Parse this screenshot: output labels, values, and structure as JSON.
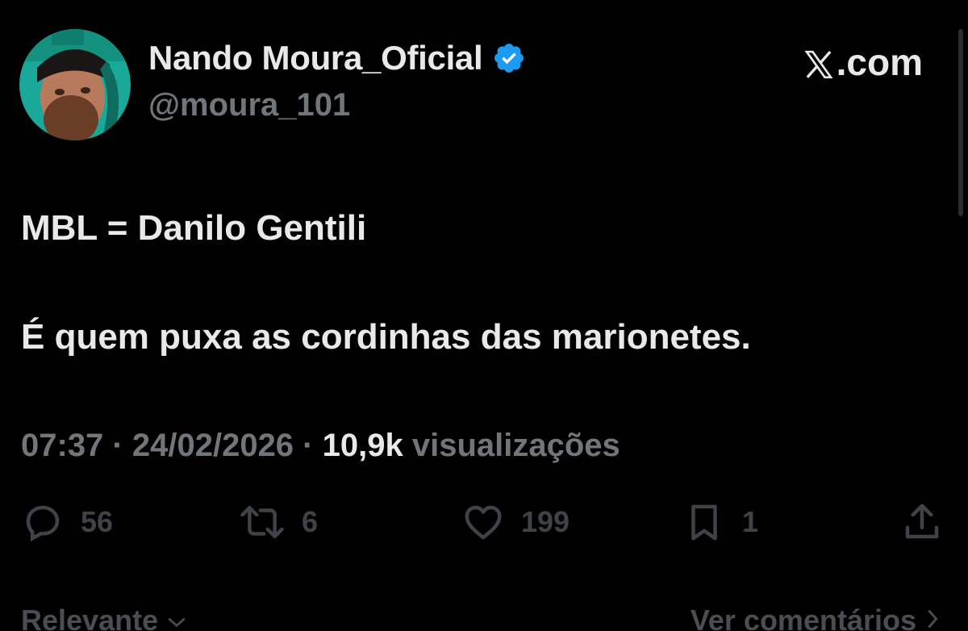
{
  "author": {
    "display_name": "Nando Moura_Oficial",
    "handle": "@moura_101",
    "verified": true,
    "verified_color": "#1d9bf0"
  },
  "source": {
    "label": ".com",
    "icon": "x-logo-icon"
  },
  "tweet": {
    "line1": "MBL = Danilo Gentili",
    "line2": "É quem puxa as cordinhas das marionetes."
  },
  "meta": {
    "time": "07:37",
    "separator1": " · ",
    "date": "24/02/2026",
    "separator2": " · ",
    "views_count": "10,9k",
    "views_label": "visualizações"
  },
  "actions": {
    "replies": "56",
    "reposts": "6",
    "likes": "199",
    "bookmarks": "1"
  },
  "footer": {
    "sort_label": "Relevante",
    "comments_link": "Ver comentários"
  },
  "colors": {
    "background": "#000000",
    "primary_text": "#e7e9ea",
    "secondary_text": "#71767b",
    "dim_text": "#3f4347"
  }
}
